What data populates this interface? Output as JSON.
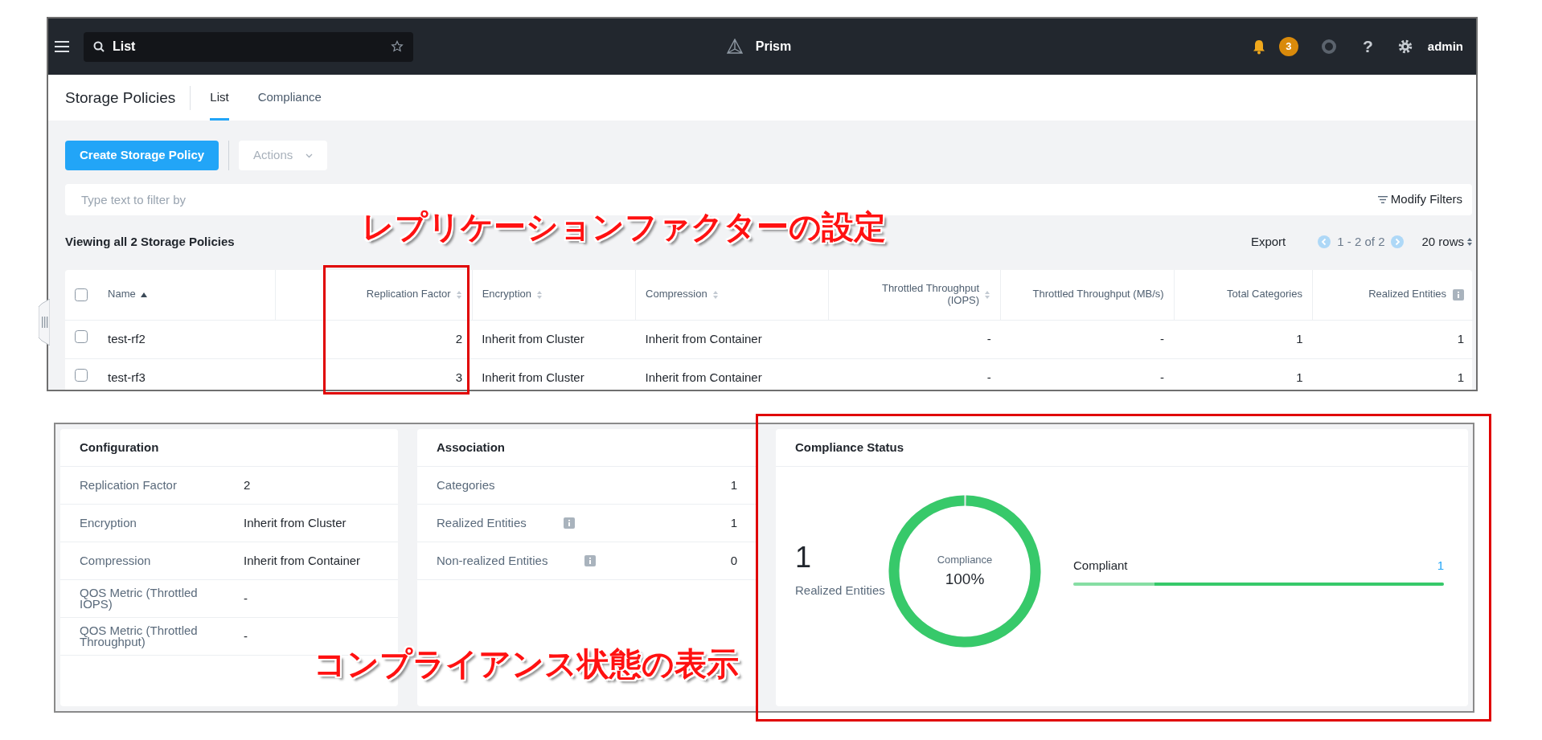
{
  "callouts": [
    {
      "text": "レプリケーションファクターの設定"
    },
    {
      "text": "コンプライアンス状態の表示"
    }
  ],
  "header": {
    "search_value": "List",
    "product": "Prism",
    "alert_count": "3",
    "help": "?",
    "user": "admin"
  },
  "page": {
    "title": "Storage Policies",
    "tabs": [
      {
        "label": "List",
        "selected": true
      },
      {
        "label": "Compliance",
        "selected": false
      }
    ]
  },
  "toolbar": {
    "create_button": "Create Storage Policy",
    "actions_button": {
      "label": "Actions",
      "disabled": true
    }
  },
  "filter": {
    "placeholder": "Type text to filter by",
    "modify_filters": "Modify Filters"
  },
  "summary": "Viewing all 2 Storage Policies",
  "pagination": {
    "export": "Export",
    "range": "1 - 2 of 2",
    "page_size": "20 rows"
  },
  "table": {
    "all_selected": false,
    "columns": [
      {
        "label": "Name",
        "kind": "text",
        "sortable": true,
        "sorted": true,
        "info": false
      },
      {
        "label": "Replication Factor",
        "kind": "number",
        "sortable": true,
        "sorted": false,
        "info": false
      },
      {
        "label": "Encryption",
        "kind": "text",
        "sortable": true,
        "sorted": false,
        "info": false
      },
      {
        "label": "Compression",
        "kind": "text",
        "sortable": true,
        "sorted": false,
        "info": false
      },
      {
        "label": "Throttled Throughput (IOPS)",
        "kind": "number",
        "sortable": true,
        "sorted": false,
        "info": false
      },
      {
        "label": "Throttled Throughput (MB/s)",
        "kind": "number",
        "sortable": false,
        "info": false
      },
      {
        "label": "Total Categories",
        "kind": "number",
        "sortable": false,
        "info": false
      },
      {
        "label": "Realized Entities",
        "kind": "number",
        "sortable": false,
        "info": true
      }
    ],
    "rows": [
      {
        "selected": false,
        "cells": [
          "test-rf2",
          "2",
          "Inherit from Cluster",
          "Inherit from Container",
          "-",
          "-",
          "1",
          "1"
        ]
      },
      {
        "selected": false,
        "cells": [
          "test-rf3",
          "3",
          "Inherit from Cluster",
          "Inherit from Container",
          "-",
          "-",
          "1",
          "1"
        ]
      }
    ]
  },
  "configuration": {
    "title": "Configuration",
    "rows": [
      {
        "label": "Replication Factor",
        "value": "2"
      },
      {
        "label": "Encryption",
        "value": "Inherit from Cluster"
      },
      {
        "label": "Compression",
        "value": "Inherit from Container"
      },
      {
        "label": "QOS Metric (Throttled IOPS)",
        "value": "-"
      },
      {
        "label": "QOS Metric (Throttled Throughput)",
        "value": "-"
      }
    ]
  },
  "association": {
    "title": "Association",
    "rows": [
      {
        "label": "Categories",
        "value": "1",
        "info": false
      },
      {
        "label": "Realized Entities",
        "value": "1",
        "info": true
      },
      {
        "label": "Non-realized Entities",
        "value": "0",
        "info": true
      }
    ]
  },
  "compliance": {
    "title": "Compliance Status",
    "count": "1",
    "count_label": "Realized Entities",
    "donut": {
      "label": "Compliance",
      "value": "100%",
      "level": 1
    },
    "legend": [
      {
        "label": "Compliant",
        "value": "1",
        "level": 1
      }
    ]
  }
}
